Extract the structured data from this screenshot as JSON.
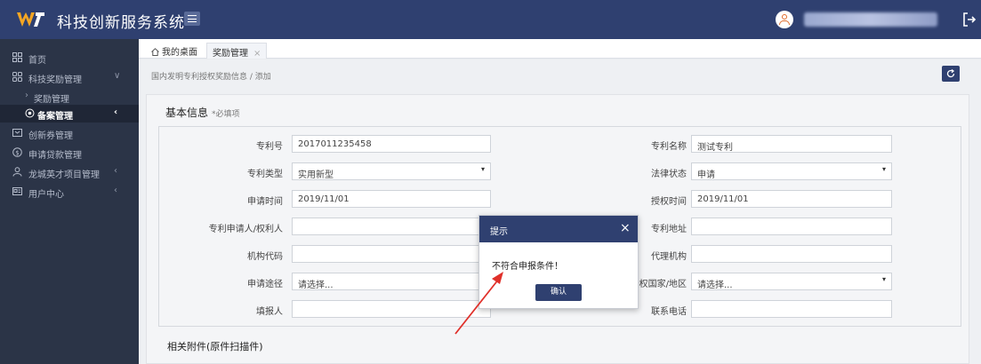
{
  "app": {
    "title": "科技创新服务系统"
  },
  "sidebar": {
    "items": [
      {
        "label": "首页",
        "icon": "grid-icon"
      },
      {
        "label": "科技奖励管理",
        "icon": "apps-icon",
        "chevron": "∨"
      },
      {
        "label": "奖励管理",
        "sub": true
      },
      {
        "label": "备案管理",
        "icon": "target-icon",
        "chevron": "‹",
        "active": true
      },
      {
        "label": "创新券管理",
        "icon": "ticket-icon"
      },
      {
        "label": "申请贷款管理",
        "icon": "dollar-icon"
      },
      {
        "label": "龙城英才项目管理",
        "icon": "person-icon",
        "chevron": "‹"
      },
      {
        "label": "用户中心",
        "icon": "card-icon",
        "chevron": "‹"
      }
    ]
  },
  "tabs": [
    {
      "label": "我的桌面"
    },
    {
      "label": "奖励管理",
      "close": "×"
    }
  ],
  "breadcrumb": "国内发明专利授权奖励信息 / 添加",
  "form": {
    "section_title": "基本信息",
    "required_hint": "*必填项",
    "fields": {
      "patent_no_label": "专利号",
      "patent_no_value": "2017011235458",
      "patent_name_label": "专利名称",
      "patent_name_value": "测试专利",
      "patent_type_label": "专利类型",
      "patent_type_value": "实用新型",
      "legal_status_label": "法律状态",
      "legal_status_value": "申请",
      "apply_time_label": "申请时间",
      "apply_time_value": "2019/11/01",
      "grant_time_label": "授权时间",
      "grant_time_value": "2019/11/01",
      "applicant_label": "专利申请人/权利人",
      "applicant_value": "",
      "address_label": "专利地址",
      "address_value": "",
      "org_code_label": "机构代码",
      "org_code_value": "",
      "agency_label": "代理机构",
      "agency_value": "",
      "route_label": "申请途径",
      "route_placeholder": "请选择...",
      "country_label": "授权国家/地区",
      "country_placeholder": "请选择...",
      "filler_label": "填报人",
      "filler_value": "",
      "phone_label": "联系电话",
      "phone_value": ""
    },
    "attachments_title": "相关附件(原件扫描件)"
  },
  "modal": {
    "title": "提示",
    "message": "不符合申报条件！",
    "confirm_label": "确认",
    "close": "×"
  },
  "colors": {
    "header": "#2f4070",
    "sidebar": "#2b3447",
    "annotation": "#e0302a"
  }
}
